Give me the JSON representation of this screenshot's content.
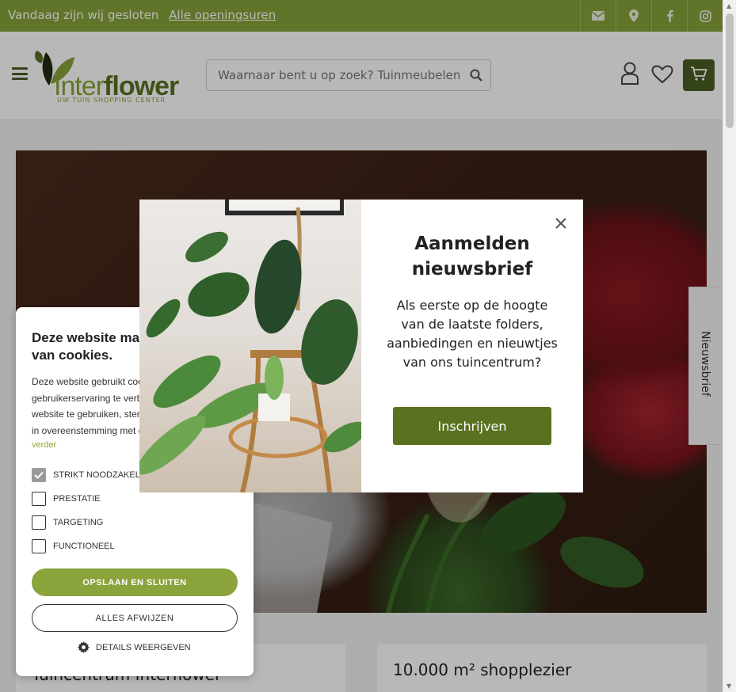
{
  "topbar": {
    "hours_text": "Vandaag zijn wij gesloten",
    "hours_link": "Alle openingsuren",
    "icons": [
      "mail-icon",
      "location-icon",
      "facebook-icon",
      "instagram-icon"
    ]
  },
  "header": {
    "logo_inter": "Inter",
    "logo_flower": "flower",
    "logo_tagline": "UW TUIN SHOPPING CENTER",
    "search_placeholder": "Waarnaar bent u op zoek? Tuinmeubelen, planten...",
    "icons": [
      "user-icon",
      "heart-icon",
      "cart-icon"
    ]
  },
  "side_tab": {
    "label": "Nieuwsbrief"
  },
  "cards": [
    {
      "title": "Tuincentrum Interflower"
    },
    {
      "title": "10.000 m² shopplezier"
    }
  ],
  "cookie": {
    "title": "Deze website maakt gebruik van cookies.",
    "body": "Deze website gebruikt cookies om de gebruikerservaring te verbeteren. Door onze website te gebruiken, stemt u in met alle cookies in overeenstemming met ons cookiebeleid.",
    "more_link": "verder",
    "options": [
      {
        "label": "STRIKT NOODZAKELIJK",
        "checked": true
      },
      {
        "label": "PRESTATIE",
        "checked": false
      },
      {
        "label": "TARGETING",
        "checked": false
      },
      {
        "label": "FUNCTIONEEL",
        "checked": false
      }
    ],
    "save_button": "OPSLAAN EN SLUITEN",
    "reject_button": "ALLES AFWIJZEN",
    "details_button": "DETAILS WEERGEVEN"
  },
  "modal": {
    "title": "Aanmelden nieuwsbrief",
    "text": "Als eerste op de hoogte van de laatste folders, aanbiedingen en nieuwtjes van ons tuincentrum?",
    "button": "Inschrijven"
  },
  "colors": {
    "brand_green": "#86a33a",
    "dark_green": "#5a7122",
    "cart_green": "#4a5d23"
  }
}
